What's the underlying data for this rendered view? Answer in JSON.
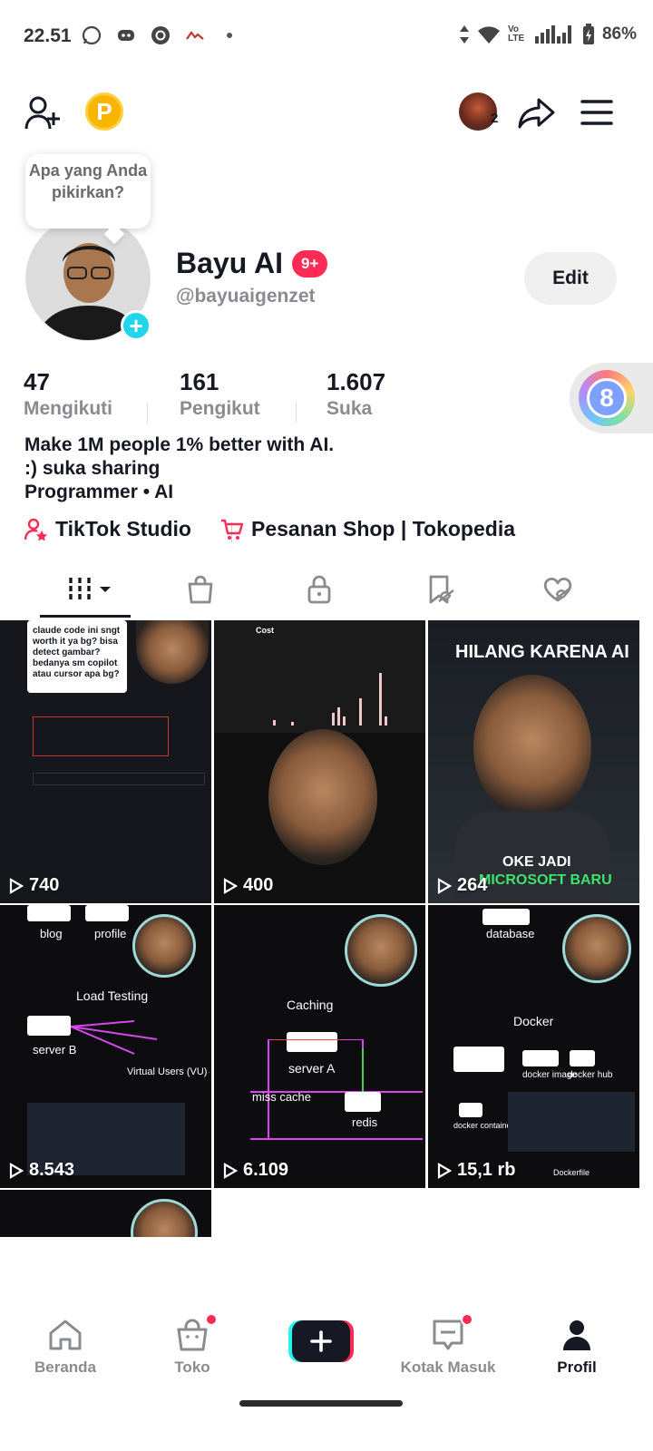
{
  "status_bar": {
    "time": "22.51",
    "battery": "86%",
    "network": "Vo LTE"
  },
  "thought_bubble": {
    "text": "Apa yang Anda pikirkan?"
  },
  "profile": {
    "display_name": "Bayu AI",
    "badge": "9+",
    "username": "@bayuaigenzet",
    "edit_label": "Edit",
    "friends_count_badge": "2"
  },
  "stats": [
    {
      "value": "47",
      "label": "Mengikuti"
    },
    {
      "value": "161",
      "label": "Pengikut"
    },
    {
      "value": "1.607",
      "label": "Suka"
    }
  ],
  "bio": {
    "line1": "Make 1M people 1% better with AI.",
    "line2": ":) suka sharing",
    "line3": "Programmer • AI"
  },
  "links": {
    "studio": "TikTok Studio",
    "shop": "Pesanan Shop | Tokopedia"
  },
  "floating_widget": {
    "value": "8"
  },
  "videos": [
    {
      "views": "740",
      "overlay": "",
      "caption_lines": [
        "claude code ini sngt",
        "worth it ya bg? bisa",
        "detect gambar?",
        "bedanya sm copilot",
        "atau cursor apa bg?"
      ]
    },
    {
      "views": "400",
      "overlay": "Cost"
    },
    {
      "views": "264",
      "overlay": "HILANG KARENA AI",
      "overlay2": "OKE JADI",
      "overlay3": "MICROSOFT BARU"
    },
    {
      "views": "8.543",
      "overlay": "Load Testing",
      "labels": [
        "blog",
        "profile",
        "server B",
        "Virtual Users (VU)"
      ]
    },
    {
      "views": "6.109",
      "overlay": "Caching",
      "labels": [
        "server A",
        "miss cache",
        "redis"
      ]
    },
    {
      "views": "15,1 rb",
      "overlay": "Docker",
      "labels": [
        "database",
        "docker image",
        "docker hub",
        "docker container",
        "Dockerfile"
      ]
    },
    {
      "views": ""
    }
  ],
  "bottom_nav": {
    "home": "Beranda",
    "shop": "Toko",
    "inbox": "Kotak Masuk",
    "profile": "Profil"
  },
  "colors": {
    "accent": "#fe2c55",
    "text": "#161823",
    "muted": "#8a8b91",
    "story_add": "#20d5ec"
  }
}
